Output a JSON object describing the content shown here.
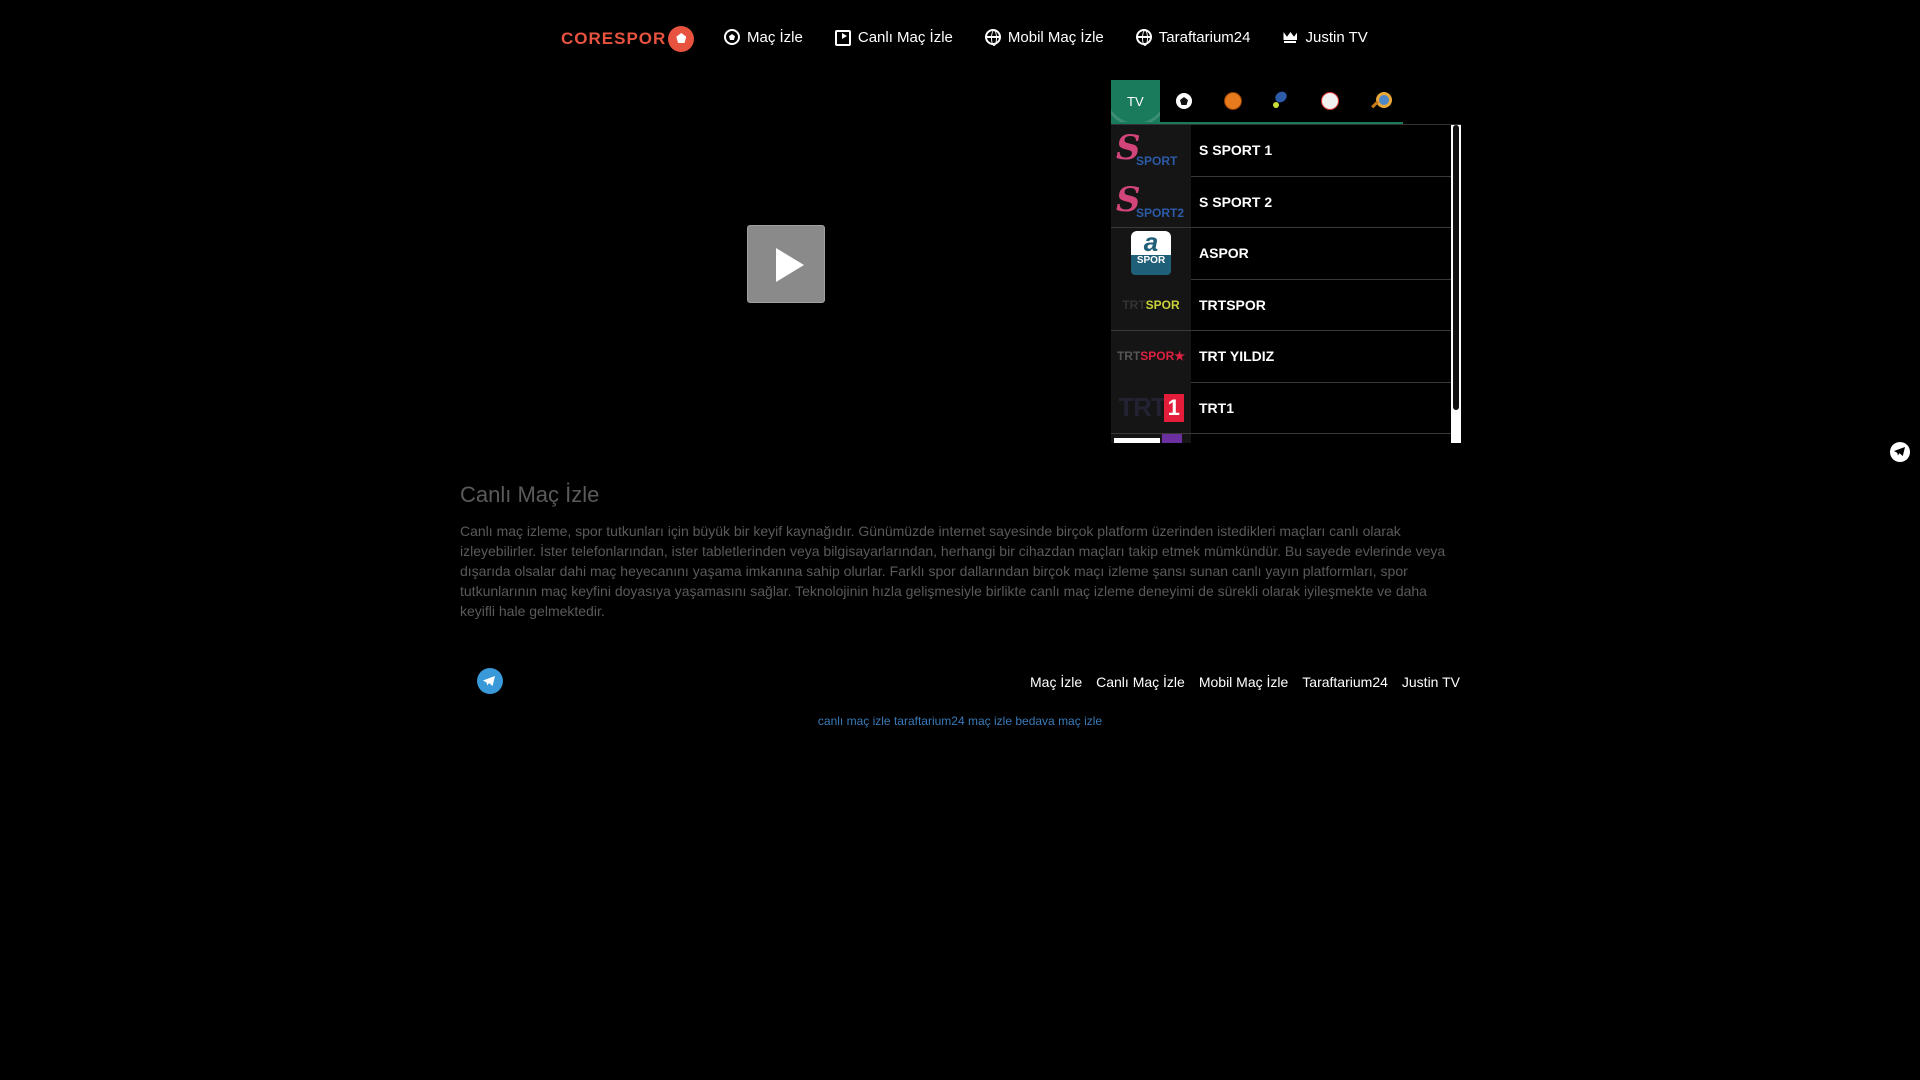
{
  "header": {
    "logo_text": "CORESPOR",
    "nav": [
      {
        "label": "Maç İzle",
        "icon": "soccer-ball-icon"
      },
      {
        "label": "Canlı Maç İzle",
        "icon": "tv-play-icon"
      },
      {
        "label": "Mobil Maç İzle",
        "icon": "globe-icon"
      },
      {
        "label": "Taraftarium24",
        "icon": "globe-icon"
      },
      {
        "label": "Justin TV",
        "icon": "crown-icon"
      }
    ]
  },
  "sidebar": {
    "tabs": [
      {
        "label": "TV",
        "icon": "tv-icon",
        "active": true
      },
      {
        "label": "",
        "icon": "football-icon"
      },
      {
        "label": "",
        "icon": "basketball-icon"
      },
      {
        "label": "",
        "icon": "tennis-icon"
      },
      {
        "label": "",
        "icon": "baseball-icon"
      },
      {
        "label": "",
        "icon": "search-icon"
      }
    ],
    "channels": [
      {
        "name": "S SPORT 1",
        "logo": "s-sport-logo"
      },
      {
        "name": "S SPORT 2",
        "logo": "s-sport2-logo"
      },
      {
        "name": "ASPOR",
        "logo": "aspor-logo"
      },
      {
        "name": "TRTSPOR",
        "logo": "trtspor-logo"
      },
      {
        "name": "TRT YILDIZ",
        "logo": "trt-yildiz-logo"
      },
      {
        "name": "TRT1",
        "logo": "trt1-logo"
      }
    ],
    "logo_texts": {
      "ssport1": "SPORT",
      "ssport2": "SPORT2",
      "aspor_a": "a",
      "aspor_sp": "SPOR",
      "trtspor_trt": "TRT",
      "trtspor_sp": "SPOR",
      "yildiz_trt": "TRT",
      "yildiz_sp": "SPOR★",
      "trt1_trt": "TRT",
      "trt1_one": "1"
    }
  },
  "content": {
    "title": "Canlı Maç İzle",
    "body": "Canlı maç izleme, spor tutkunları için büyük bir keyif kaynağıdır. Günümüzde internet sayesinde birçok platform üzerinden istedikleri maçları canlı olarak izleyebilirler. İster telefonlarından, ister tabletlerinden veya bilgisayarlarından, herhangi bir cihazdan maçları takip etmek mümkündür. Bu sayede evlerinde veya dışarıda olsalar dahi maç heyecanını yaşama imkanına sahip olurlar. Farklı spor dallarından birçok maçı izleme şansı sunan canlı yayın platformları, spor tutkunlarının maç keyfini doyasıya yaşamasını sağlar. Teknolojinin hızla gelişmesiyle birlikte canlı maç izleme deneyimi de sürekli olarak iyileşmekte ve daha keyifli hale gelmektedir."
  },
  "footer": {
    "links": [
      "Maç İzle",
      "Canlı Maç İzle",
      "Mobil Maç İzle",
      "Taraftarium24",
      "Justin TV"
    ],
    "seo_links": [
      "canlı maç izle",
      "taraftarium24",
      "maç izle",
      "bedava maç izle"
    ]
  },
  "colors": {
    "accent": "#1a7a5c",
    "logo": "#e8533f",
    "link": "#3a7ab8",
    "telegram": "#3a9ad9"
  }
}
